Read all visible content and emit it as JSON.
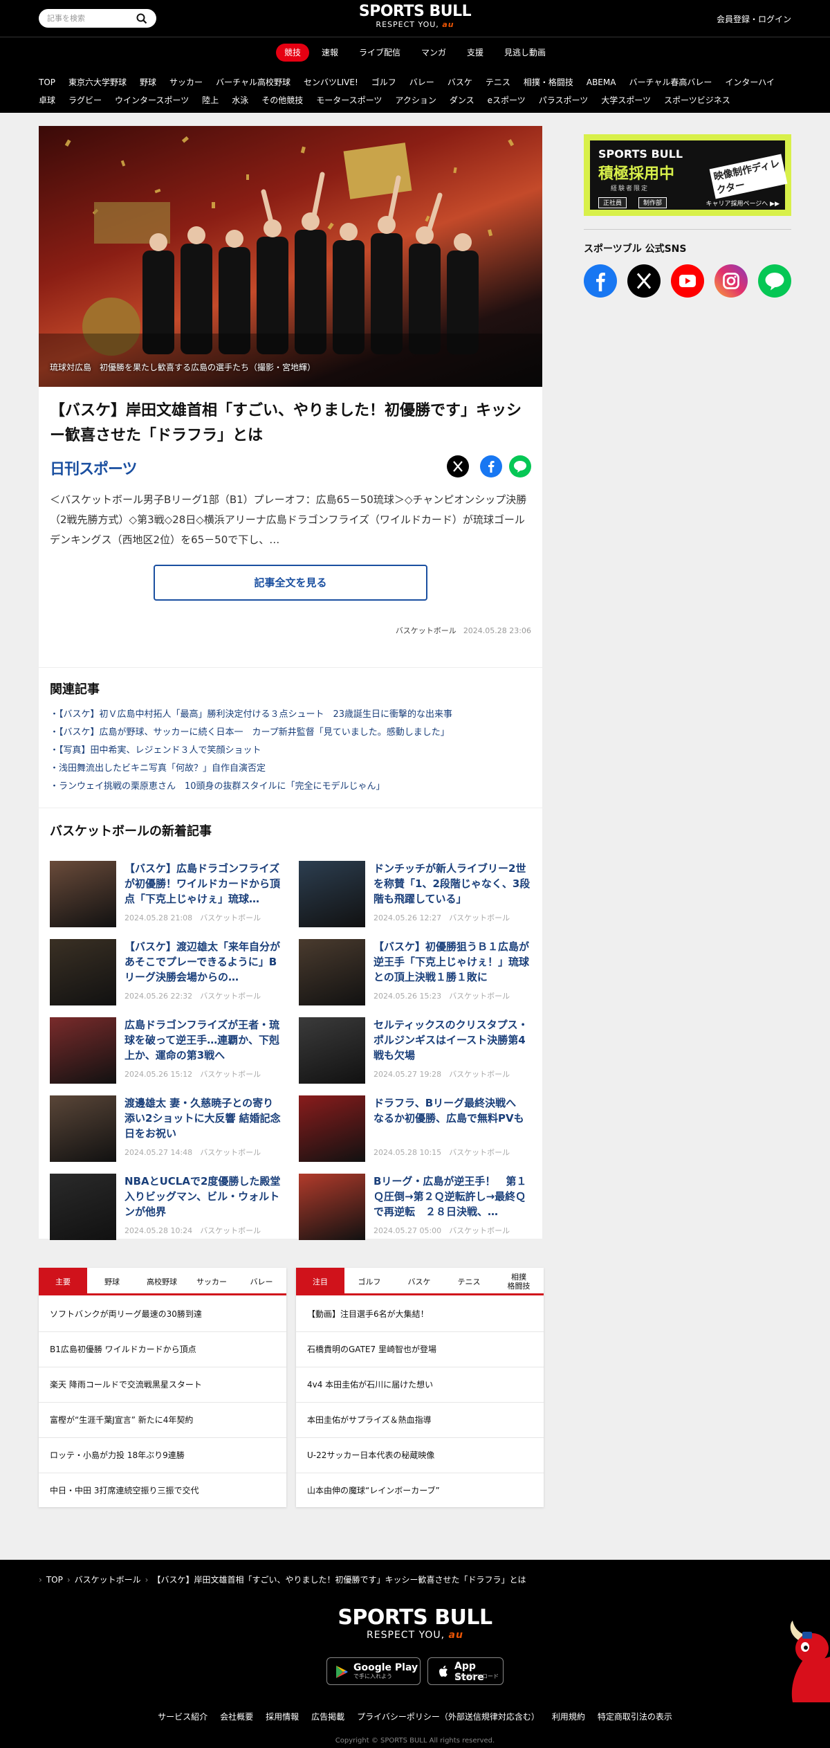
{
  "header": {
    "search_placeholder": "記事を検索",
    "logo_main": "SPORTS BULL",
    "logo_sub": "RESPECT YOU,",
    "logo_au": "au",
    "login": "会員登録・ログイン",
    "global_nav": [
      "競技",
      "速報",
      "ライブ配信",
      "マンガ",
      "支援",
      "見逃し動画"
    ],
    "sub_nav_row1": [
      "TOP",
      "東京六大学野球",
      "野球",
      "サッカー",
      "バーチャル高校野球",
      "センバツLIVE!",
      "ゴルフ",
      "バレー",
      "バスケ",
      "テニス",
      "相撲・格闘技",
      "ABEMA",
      "バーチャル春高バレー",
      "インターハイ"
    ],
    "sub_nav_row2": [
      "卓球",
      "ラグビー",
      "ウインタースポーツ",
      "陸上",
      "水泳",
      "その他競技",
      "モータースポーツ",
      "アクション",
      "ダンス",
      "eスポーツ",
      "パラスポーツ",
      "大学スポーツ",
      "スポーツビジネス"
    ]
  },
  "article": {
    "caption": "琉球対広島　初優勝を果たし歓喜する広島の選手たち（撮影・宮地輝）",
    "title": "【バスケ】岸田文雄首相「すごい、やりました！初優勝です」キッシー歓喜させた「ドラフラ」とは",
    "source": "日刊スポーツ",
    "lead": "＜バスケットボール男子Bリーグ1部（B1）プレーオフ：広島65－50琉球＞◇チャンピオンシップ決勝（2戦先勝方式）◇第3戦◇28日◇横浜アリーナ広島ドラゴンフライズ（ワイルドカード）が琉球ゴールデンキングス（西地区2位）を65－50で下し、…",
    "more_button": "記事全文を見る",
    "category": "バスケットボール",
    "date": "2024.05.28 23:06"
  },
  "related": {
    "heading": "関連記事",
    "items": [
      "・【バスケ】初Ｖ広島中村拓人「最高」勝利決定付ける３点シュート　23歳誕生日に衝撃的な出来事",
      "・【バスケ】広島が野球、サッカーに続く日本一　カープ新井監督「見ていました。感動しました」",
      "・【写真】田中希実、レジェンド３人で笑顔ショット",
      "・浅田舞流出したビキニ写真「何故？」自作自演否定",
      "・ランウェイ挑戦の栗原恵さん　10頭身の抜群スタイルに「完全にモデルじゃん」"
    ]
  },
  "latest": {
    "heading": "バスケットボールの新着記事",
    "items": [
      {
        "title": "【バスケ】広島ドラゴンフライズが初優勝！ワイルドカードから頂点「下克上じゃけぇ」琉球…",
        "date": "2024.05.28 21:08",
        "cat": "バスケットボール"
      },
      {
        "title": "ドンチッチが新人ライブリー2世を称賛「1、2段階じゃなく、3段階も飛躍している」",
        "date": "2024.05.26 12:27",
        "cat": "バスケットボール"
      },
      {
        "title": "【バスケ】渡辺雄太「来年自分があそこでプレーできるように」Bリーグ決勝会場からの…",
        "date": "2024.05.26 22:32",
        "cat": "バスケットボール"
      },
      {
        "title": "【バスケ】初優勝狙うＢ１広島が逆王手「下克上じゃけぇ！」琉球との頂上決戦１勝１敗に",
        "date": "2024.05.26 15:23",
        "cat": "バスケットボール"
      },
      {
        "title": "広島ドラゴンフライズが王者・琉球を破って逆王手…連覇か、下剋上か、運命の第3戦へ",
        "date": "2024.05.26 15:12",
        "cat": "バスケットボール"
      },
      {
        "title": "セルティックスのクリスタプス・ポルジンギスはイースト決勝第4戦も欠場",
        "date": "2024.05.27 19:28",
        "cat": "バスケットボール"
      },
      {
        "title": "渡邊雄太 妻・久慈暁子との寄り添い2ショットに大反響 結婚記念日をお祝い",
        "date": "2024.05.27 14:48",
        "cat": "バスケットボール"
      },
      {
        "title": "ドラフラ、Bリーグ最終決戦へ　なるか初優勝、広島で無料PVも",
        "date": "2024.05.28 10:15",
        "cat": "バスケットボール"
      },
      {
        "title": "NBAとUCLAで2度優勝した殿堂入りビッグマン、ビル・ウォルトンが他界",
        "date": "2024.05.28 10:24",
        "cat": "バスケットボール"
      },
      {
        "title": "Bリーグ・広島が逆王手！　第１Ｑ圧倒→第２Ｑ逆転許し→最終Ｑで再逆転　２８日決戦、…",
        "date": "2024.05.27 05:00",
        "cat": "バスケットボール"
      }
    ]
  },
  "sidebar": {
    "banner_l1": "SPORTS BULL",
    "banner_l2": "積極採用中",
    "banner_l3": "経験者限定",
    "banner_tag1": "正社員",
    "banner_tag2": "制作部",
    "banner_link": "キャリア採用ページへ ▶▶",
    "banner_role": "映像制作ディレクター",
    "sns_heading": "スポーツブル 公式SNS"
  },
  "rank_left": {
    "tabs": [
      "主要",
      "野球",
      "高校野球",
      "サッカー",
      "バレー"
    ],
    "items": [
      "ソフトバンクが両リーグ最速の30勝到達",
      "B1広島初優勝 ワイルドカードから頂点",
      "楽天 降雨コールドで交流戦黒星スタート",
      "富樫が“生涯千葉J宣言” 新たに4年契約",
      "ロッテ・小島が力投 18年ぶり9連勝",
      "中日・中田 3打席連続空振り三振で交代"
    ]
  },
  "rank_right": {
    "tabs": [
      "注目",
      "ゴルフ",
      "バスケ",
      "テニス",
      "相撲\n格闘技"
    ],
    "items": [
      "【動画】注目選手6名が大集結！",
      "石橋貴明のGATE7 里崎智也が登場",
      "4v4 本田圭佑が石川に届けた想い",
      "本田圭佑がサプライズ＆熱血指導",
      "U-22サッカー日本代表の秘蔵映像",
      "山本由伸の魔球“レインボーカーブ”"
    ]
  },
  "footer": {
    "breadcrumb": [
      "TOP",
      "バスケットボール",
      "【バスケ】岸田文雄首相「すごい、やりました！初優勝です」キッシー歓喜させた「ドラフラ」とは"
    ],
    "logo_main": "SPORTS BULL",
    "logo_sub": "RESPECT YOU,",
    "logo_au": "au",
    "google_play": "Google Play",
    "google_play_sub": "で手に入れよう",
    "app_store": "App Store",
    "app_store_sub": "からダウンロード",
    "links": [
      "サービス紹介",
      "会社概要",
      "採用情報",
      "広告掲載",
      "プライバシーポリシー（外部送信規律対応含む）",
      "利用規約",
      "特定商取引法の表示"
    ],
    "copyright": "Copyright © SPORTS BULL All rights reserved."
  },
  "colors": {
    "accent_red": "#e60012",
    "link_blue": "#1a3f7a",
    "banner_lime": "#d8f04a"
  }
}
